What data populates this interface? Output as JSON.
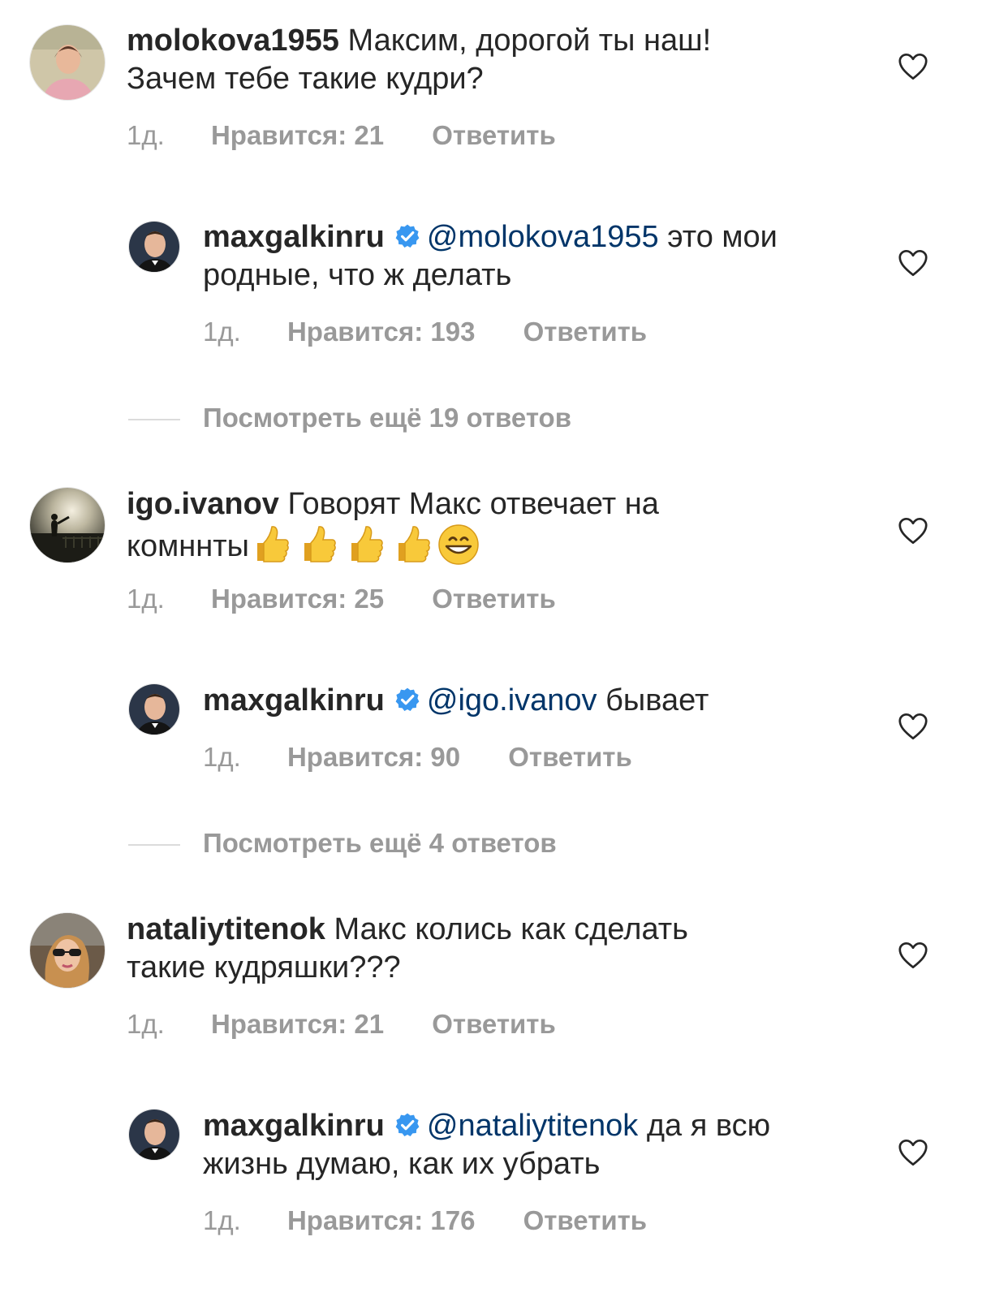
{
  "colors": {
    "text": "#262626",
    "meta": "#999999",
    "mention": "#003569",
    "verified": "#3897f0"
  },
  "comments": [
    {
      "username": "molokova1955",
      "text_line1": "Максим, дорогой ты наш!",
      "text_line2": "Зачем тебе такие кудри?",
      "time": "1д.",
      "likes": "Нравится: 21",
      "reply": "Ответить",
      "replies": [
        {
          "username": "maxgalkinru",
          "mention": "@molokova1955",
          "text_line1": "это мои",
          "text_line2": "родные, что ж делать",
          "time": "1д.",
          "likes": "Нравится: 193",
          "reply": "Ответить"
        }
      ],
      "view_more": "Посмотреть ещё 19 ответов"
    },
    {
      "username": "igo.ivanov",
      "text_line1": "Говорят Макс отвечает на",
      "text_line2": "комннты",
      "emojis": [
        "thumbs-up",
        "thumbs-up",
        "thumbs-up",
        "thumbs-up",
        "grinning-face"
      ],
      "time": "1д.",
      "likes": "Нравится: 25",
      "reply": "Ответить",
      "replies": [
        {
          "username": "maxgalkinru",
          "mention": "@igo.ivanov",
          "text_line1": "бывает",
          "time": "1д.",
          "likes": "Нравится: 90",
          "reply": "Ответить"
        }
      ],
      "view_more": "Посмотреть ещё 4 ответов"
    },
    {
      "username": "nataliytitenok",
      "text_line1": "Макс колись как сделать",
      "text_line2": "такие кудряшки???",
      "time": "1д.",
      "likes": "Нравится: 21",
      "reply": "Ответить",
      "replies": [
        {
          "username": "maxgalkinru",
          "mention": "@nataliytitenok",
          "text_line1": "да я всю",
          "text_line2": "жизнь думаю, как их убрать",
          "time": "1д.",
          "likes": "Нравится: 176",
          "reply": "Ответить"
        }
      ]
    }
  ]
}
